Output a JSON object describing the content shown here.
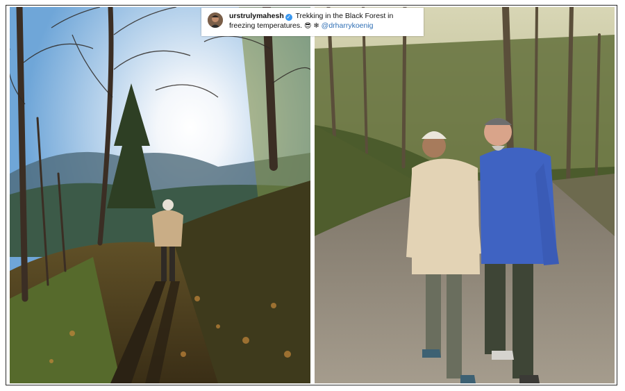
{
  "post": {
    "username": "urstrulymahesh",
    "verified_glyph": "✓",
    "caption_text": "Trekking in the Black Forest in freezing temperatures.",
    "emoji_1": "😎",
    "emoji_2": "❄",
    "mention": "@drharrykoenig"
  },
  "icons": {
    "verified": "verified-badge-icon",
    "avatar": "profile-avatar"
  },
  "colors": {
    "mention": "#2f6fb5",
    "verified": "#3897f0",
    "frame_border": "#2b2b2b"
  }
}
